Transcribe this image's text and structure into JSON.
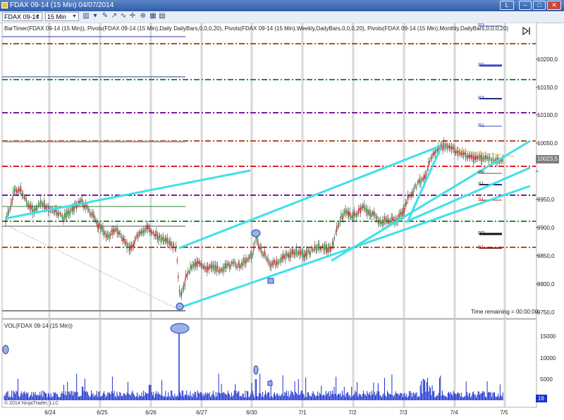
{
  "window": {
    "title": "FDAX 09-14 (15 Min)  04/07/2014",
    "button_label": "L"
  },
  "toolbar": {
    "instrument": "FDAX 09-14",
    "interval": "15 Min"
  },
  "indicator_caption": "BarTimer(FDAX 09-14 (15 Min)), Pivots(FDAX 09-14 (15 Min),Daily DailyBars,0,0,0,20), Pivots(FDAX 09-14 (15 Min),Weekly,DailyBars,0,0,0,20), Pivots(FDAX 09-14 (15 Min),Monthly,DailyBars,0,0,0,20)",
  "price_axis": {
    "labels": [
      "10200,0",
      "10150,0",
      "10100,0",
      "10050,0",
      "9950,0",
      "9900,0",
      "9850,0",
      "9800,0",
      "9750,0"
    ],
    "current_price": "10023,5",
    "current_color": "#7d7d7d"
  },
  "pivot_labels": [
    "R3",
    "R2",
    "R3",
    "R1",
    "PP",
    "S1",
    "S1",
    "PP",
    "S1"
  ],
  "time_remaining": "Time remaining = 00:00:00",
  "volume_panel": {
    "caption": "VOL(FDAX 09-14 (15 Min))",
    "labels": [
      "15000",
      "10000",
      "5000"
    ],
    "current": "16"
  },
  "date_labels": [
    "6/24",
    "6/25",
    "6/26",
    "6/27",
    "6/30",
    "7/1",
    "7/2",
    "7/3",
    "7/4",
    "7/5"
  ],
  "copyright": "© 2014 NinjaTrader, LLC",
  "colors": {
    "trendline": "#40e0e8",
    "daily_pivot": "#e02020",
    "weekly_pivot": "#7a1a9a",
    "monthly_pivot": "#2a8a3a",
    "resistance_brown": "#b05020",
    "volume": "#1a30d0",
    "up_candle": "#2a9a2a",
    "down_candle": "#cc2020"
  }
}
